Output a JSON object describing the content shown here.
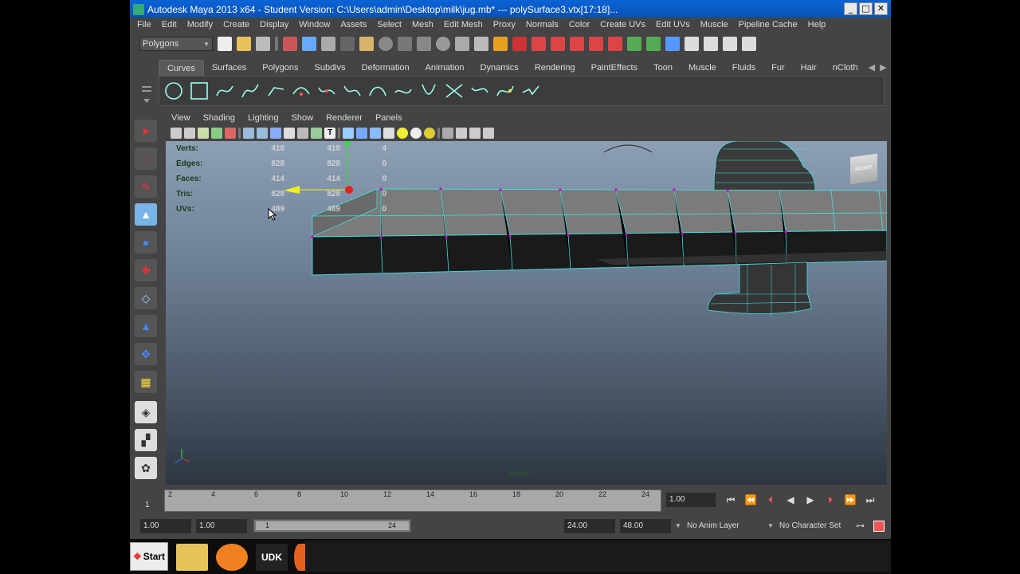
{
  "window": {
    "title": "Autodesk Maya 2013 x64 - Student Version: C:\\Users\\admin\\Desktop\\milk\\jug.mb*   ---   polySurface3.vtx[17:18]...",
    "minimize": "_",
    "maximize": "□",
    "close": "✕"
  },
  "menubar": [
    "File",
    "Edit",
    "Modify",
    "Create",
    "Display",
    "Window",
    "Assets",
    "Select",
    "Mesh",
    "Edit Mesh",
    "Proxy",
    "Normals",
    "Color",
    "Create UVs",
    "Edit UVs",
    "Muscle",
    "Pipeline Cache",
    "Help"
  ],
  "status_line": {
    "menu_set": "Polygons"
  },
  "shelf_tabs": [
    "Curves",
    "Surfaces",
    "Polygons",
    "Subdivs",
    "Deformation",
    "Animation",
    "Dynamics",
    "Rendering",
    "PaintEffects",
    "Toon",
    "Muscle",
    "Fluids",
    "Fur",
    "Hair",
    "nCloth"
  ],
  "active_shelf_tab": "Curves",
  "panel_menu": [
    "View",
    "Shading",
    "Lighting",
    "Show",
    "Renderer",
    "Panels"
  ],
  "hud": {
    "rows": [
      {
        "label": "Verts:",
        "v1": "418",
        "v2": "418",
        "v3": "4"
      },
      {
        "label": "Edges:",
        "v1": "828",
        "v2": "828",
        "v3": "0"
      },
      {
        "label": "Faces:",
        "v1": "414",
        "v2": "414",
        "v3": "0"
      },
      {
        "label": "Tris:",
        "v1": "828",
        "v2": "828",
        "v3": "0"
      },
      {
        "label": "UVs:",
        "v1": "489",
        "v2": "489",
        "v3": "0"
      }
    ],
    "camera": "persp",
    "view_cube": "RIGHT"
  },
  "timeline": {
    "ticks": [
      "2",
      "4",
      "6",
      "8",
      "10",
      "12",
      "14",
      "16",
      "18",
      "20",
      "22",
      "24"
    ],
    "current_frame_marker": "1",
    "current_time": "1.00"
  },
  "range": {
    "start": "1.00",
    "playback_start": "1.00",
    "slider_start": "1",
    "slider_end": "24",
    "playback_end": "24.00",
    "end": "48.00",
    "anim_layer": "No Anim Layer",
    "character_set": "No Character Set"
  },
  "taskbar": {
    "start": "Start"
  },
  "colors": {
    "titlebar": "#0b5fd0",
    "ui_bg": "#444444",
    "wireframe": "#44e0e0",
    "selection": "#cc00cc"
  }
}
